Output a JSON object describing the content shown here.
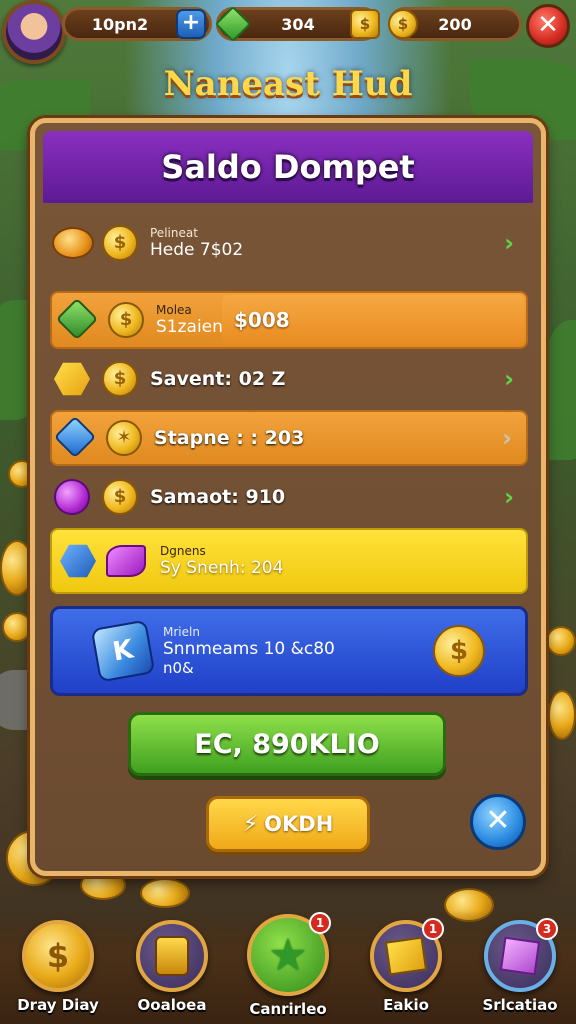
{
  "topbar": {
    "player_label": "10pn2",
    "plus": "+",
    "gems": "304",
    "coins": "200",
    "close": "✕"
  },
  "game_title": "Naneast Hud",
  "panel": {
    "title": "Saldo Dompet",
    "rows": [
      {
        "label": "Pelineat",
        "value": "Hede 7$02"
      },
      {
        "label": "Molea",
        "value": "S1zaien",
        "amount": "$008"
      },
      {
        "value": "Savent: 02 Z"
      },
      {
        "value": "Stapne : : 203"
      },
      {
        "value": "Samaot: 910"
      },
      {
        "label": "Dgnens",
        "value": "Sy Snenh: 204"
      },
      {
        "label": "Mrieln",
        "value": "Snnmeams 10 &c80",
        "sub": "n0&"
      }
    ],
    "green_button": "EC, 890KLIO",
    "yellow_button": "OKDH",
    "close_button": "✕"
  },
  "nav": [
    {
      "label": "Dray Diay",
      "icon": "coin-icon"
    },
    {
      "label": "Ooaloea",
      "icon": "chest-icon"
    },
    {
      "label": "Canrirleo",
      "icon": "star-icon",
      "badge": "1"
    },
    {
      "label": "Eakio",
      "icon": "box-icon",
      "badge": "1"
    },
    {
      "label": "Srlcatiao",
      "icon": "cube-icon",
      "badge": "3"
    }
  ],
  "colors": {
    "panel_header": "#6a22a8",
    "accent_gold": "#ffd84a",
    "green": "#4fb02a",
    "blue": "#2a50d0"
  }
}
